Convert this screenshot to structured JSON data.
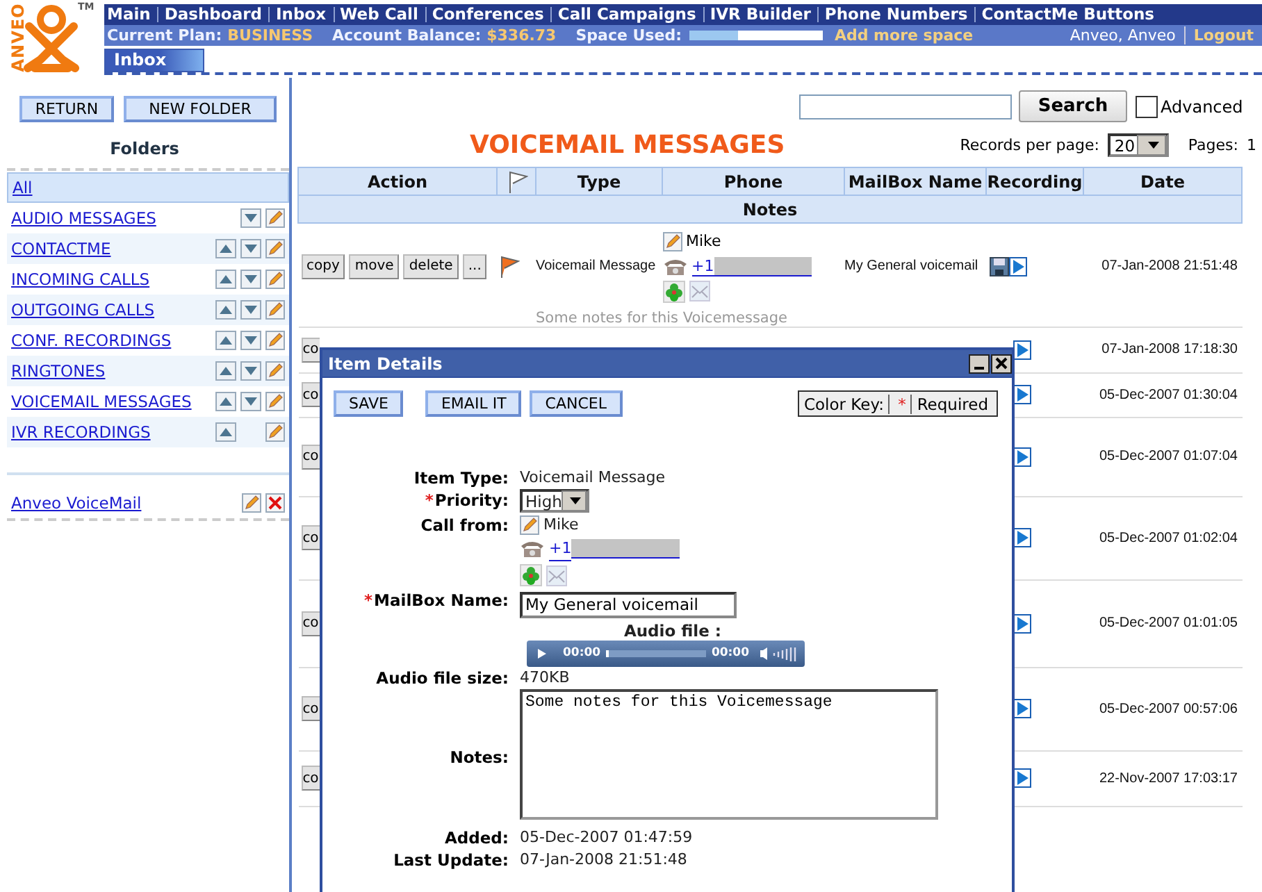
{
  "header": {
    "logo": "ANVEO",
    "trademark": "TM",
    "nav": [
      "Main",
      "Dashboard",
      "Inbox",
      "Web Call",
      "Conferences",
      "Call Campaigns",
      "IVR Builder",
      "Phone Numbers",
      "ContactMe Buttons"
    ],
    "plan_label": "Current Plan:",
    "plan": "BUSINESS",
    "balance_label": "Account Balance:",
    "balance": "$336.73",
    "space_label": "Space Used:",
    "space_used": {
      "level": 0.36
    },
    "add_space": "Add more space",
    "user": "Anveo, Anveo",
    "logout": "Logout",
    "tabs": [
      {
        "label": "Inbox",
        "selected": true
      }
    ]
  },
  "sidebar": {
    "buttons": [
      "RETURN",
      "NEW FOLDER"
    ],
    "title": "Folders",
    "all": {
      "label": "All",
      "selected": true
    },
    "folders": [
      {
        "label": "AUDIO MESSAGES",
        "selected": false,
        "move_up": false,
        "move_down": true
      },
      {
        "label": "CONTACTME",
        "selected": false,
        "move_up": true,
        "move_down": true
      },
      {
        "label": "INCOMING CALLS",
        "selected": false,
        "move_up": true,
        "move_down": true
      },
      {
        "label": "OUTGOING CALLS",
        "selected": false,
        "move_up": true,
        "move_down": true
      },
      {
        "label": "CONF. RECORDINGS",
        "selected": false,
        "move_up": true,
        "move_down": true
      },
      {
        "label": "RINGTONES",
        "selected": false,
        "move_up": true,
        "move_down": true
      },
      {
        "label": "VOICEMAIL MESSAGES",
        "selected": false,
        "move_up": true,
        "move_down": true
      },
      {
        "label": "IVR RECORDINGS",
        "selected": false,
        "move_up": true,
        "move_down": false
      }
    ],
    "custom_folders": [
      {
        "label": "Anveo VoiceMail"
      }
    ]
  },
  "search": {
    "button": "Search",
    "advanced": {
      "label": "Advanced",
      "checked": false
    }
  },
  "title": "VOICEMAIL MESSAGES",
  "records_per_page": {
    "label": "Records per page:",
    "value": "20"
  },
  "pages": {
    "label": "Pages:",
    "value": "1"
  },
  "table": {
    "columns": [
      "Action",
      "Type",
      "Phone",
      "MailBox Name",
      "Recording",
      "Date"
    ],
    "notes_header": "Notes",
    "rows": [
      {
        "kind": "full",
        "actions": [
          "copy",
          "move",
          "delete",
          "..."
        ],
        "flagged": true,
        "type": "Voicemail Message",
        "contact": "Mike",
        "phone": "+1",
        "mailbox": "My General voicemail",
        "date": "07-Jan-2008 21:51:48",
        "notes": "Some notes for this Voicemessage"
      },
      {
        "kind": "covered",
        "action": "co",
        "date": "07-Jan-2008 17:18:30"
      },
      {
        "kind": "covered",
        "action": "co",
        "date": "05-Dec-2007 01:30:04"
      },
      {
        "kind": "covered",
        "action": "co",
        "date": "05-Dec-2007 01:07:04"
      },
      {
        "kind": "covered",
        "action": "co",
        "date": "05-Dec-2007 01:02:04"
      },
      {
        "kind": "covered",
        "action": "co",
        "date": "05-Dec-2007 01:01:05"
      },
      {
        "kind": "covered",
        "action": "co",
        "date": "05-Dec-2007 00:57:06"
      },
      {
        "kind": "covered",
        "action": "co",
        "date": "22-Nov-2007 17:03:17"
      }
    ]
  },
  "dialog": {
    "title": "Item Details",
    "buttons": [
      "SAVE",
      "EMAIL IT",
      "CANCEL"
    ],
    "color_key": {
      "label": "Color Key:",
      "required": "Required"
    },
    "required_marker": "*",
    "fields": [
      {
        "kind": "text",
        "label": "Item Type:",
        "required": false,
        "value": "Voicemail Message"
      },
      {
        "kind": "select",
        "label": "Priority:",
        "required": true,
        "value": "High"
      },
      {
        "kind": "caller",
        "label": "Call from:",
        "required": false,
        "name": "Mike",
        "phone": "+1"
      },
      {
        "kind": "input",
        "label": "MailBox Name:",
        "required": true,
        "value": "My General voicemail"
      },
      {
        "kind": "audio",
        "label": "Audio file :",
        "elapsed": "00:00",
        "duration": "00:00"
      },
      {
        "kind": "text",
        "label": "Audio file size:",
        "required": false,
        "value": "470KB"
      },
      {
        "kind": "textarea",
        "label": "Notes:",
        "required": false,
        "value": "Some notes for this Voicemessage"
      },
      {
        "kind": "text",
        "label": "Added:",
        "required": false,
        "value": "05-Dec-2007 01:47:59"
      },
      {
        "kind": "text",
        "label": "Last Update:",
        "required": false,
        "value": "07-Jan-2008 21:51:48"
      }
    ]
  }
}
